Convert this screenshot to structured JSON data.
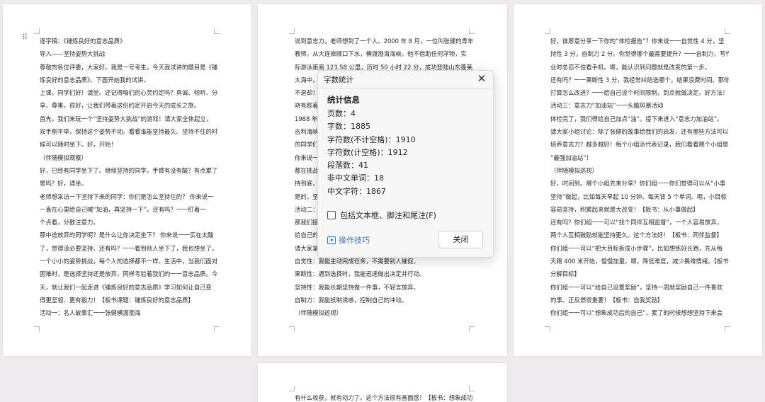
{
  "pages": [
    {
      "lines": [
        "逐字稿：《锤炼良好的意志品质》",
        "导入——坚持姿势大挑战",
        "尊敬的各位评委，大家好。我是一号考生，今天我试讲的题目是《锤",
        "炼良好的意志品质》。下面开始我的试讲。",
        "上课，同学们好！请坐。还记得咱们的心灵约定吗？真诚、倾听、分",
        "享、尊重。很好，让我们带着这份约定开启今天的成长之旅。",
        "首先，我们来玩一个“坚持姿势大挑战”的游戏！请大家全体起立，",
        "双手侧平举，保持这个姿势不动。看看谁能坚持最久。坚持不住的时",
        "候可以随时坐下。好，开始！",
        "（伴随模拟观察）",
        "好，已经有同学坐下了。继续坚持的同学，手臂有没有酸？有点累了",
        "是吗？好，请坐。",
        "老师想采访一下坚持下来的同学：你们是怎么坚持住的？ 你来说一",
        "一直在心里给自己喊“加油，再坚持一下”。还有吗？一一盯着一",
        "个点看，分散注意力。",
        "那中途放弃的同学呢？是什么让你决定坐下？ 你来说一一实在太酸",
        "了，觉得没必要坚持。还有吗？一一看到别人坐下了，我也想坐了。",
        "一个小小的姿势挑战，每个人的选择都不一样。生活中，当我们面对",
        "困难时，是选择坚持还是放弃，同样考验着我们的一一意志品质。今",
        "天，就让我们一起走进《锤炼良好的意志品质》学习如何让自己变",
        "得更坚韧、更有毅力！【板书课题：锤炼良好的意志品质】",
        "活动一：名人故事汇一一张健横渡渤海"
      ]
    },
    {
      "lines": [
        "说到意志力，老师想到了一个人。2000 年 8 月，一位叫张健的青年",
        "教师，从大连旅顺口下水，横渡渤海海峡。他不借助任何浮物，实",
        "际游泳距离 123.58 公里，历时 50 小时 22 分，成功登陆山东蓬莱。",
        "大海中，",
        "不退却！",
        "晓有趁着",
        "1988 年",
        "吉利海峡",
        "的同学们",
        "你来说一",
        "都在挑战",
        "持到底，坚",
        "是的，坚",
        "活动二：",
        "那我们接",
        "给自己的",
        "请大家拿",
        "自觉性：我能主动完成任务，不需要别人催促。",
        "果断性：遇到选择时，我能迅速做出决定并行动。",
        "坚持性：我能长期坚持做一件事，不轻言放弃。",
        "自制力：我能抵制诱惑，控制自己的冲动。",
        "（伴随模拟巡视）"
      ]
    },
    {
      "lines": [
        "好，谁愿意分享一下你的“体检报告”？你来说一一自觉性 4 分，坚",
        "持性 3 分，自制力 2 分。你觉得哪个最需要提升？一一自制力，写作",
        "业时总忍不住看手机。嗯，能认识到问题就是改变的第一步。",
        "还有吗？一一果断性 3 分，我经常纠结选哪个，结果浪费时间。那你",
        "打算怎么改进？一一给自己设个时间限制，到点就做决定。好方法！",
        "活动三：意志力“加油站”一一头脑风暴活动",
        "体检完了，我们得给自己加点“油”。接下来进入“意志力加油站”。",
        "请大家小组讨论：除了张健的故事给我们的启发，还有哪些方法可以",
        "培养意志力？越多越好！每个小组派代表记录，我们看看哪个小组是",
        "“最强加油站”！",
        "（伴随模拟巡视）",
        "好，时间到。哪个小组先来分享？你们组一一你们觉得可以从“小事",
        "坚持”做起，比如每天早起 10 分钟、每天背 5 个单词。嗯，小目标",
        "容易坚持，积累起来就是大改变！【板书：从小事做起】",
        "还有吗？你们组一一可以“找个同伴互相监督”，一个人容易放弃，",
        "两个人互相鼓励就能坚持更久。这个方法好！【板书：同伴监督】",
        "你们组一一可以“把大目标拆成小步骤”，比如想练好长跑，先从每",
        "天跑 400 米开始，慢慢加量。嗯，降低难度，减少畏难情绪。【板书：",
        "分解目标】",
        "你们组一一可以“给自己设置奖励”，坚持一周就奖励自己一件喜欢",
        "的事。正反馈很重要！【板书：自我奖励】",
        "你们组一一可以“想象成功后的自己”，累了的时候想想坚持下来会"
      ]
    },
    {
      "lines": [
        "有什么收获，就有动力了。这个方法很有画面感！【板书：想象成功】"
      ]
    }
  ],
  "dialog": {
    "title": "字数统计",
    "heading": "统计信息",
    "stats": [
      "页数：4",
      "字数：1885",
      "字符数(不计空格)：1910",
      "字符数(计空格)：1912",
      "段落数：41",
      "非中文单词：18",
      "中文字符：1867"
    ],
    "checkbox_label": "包括文本框、脚注和尾注(F)",
    "checkbox_checked": false,
    "tips_label": "操作技巧",
    "close_button": "关闭",
    "close_icon": "close-icon",
    "tips_icon": "play-icon"
  },
  "colors": {
    "background": "#eeeaee",
    "page": "#ffffff",
    "dialog": "#f7f7f7",
    "link": "#3a6fd9"
  }
}
